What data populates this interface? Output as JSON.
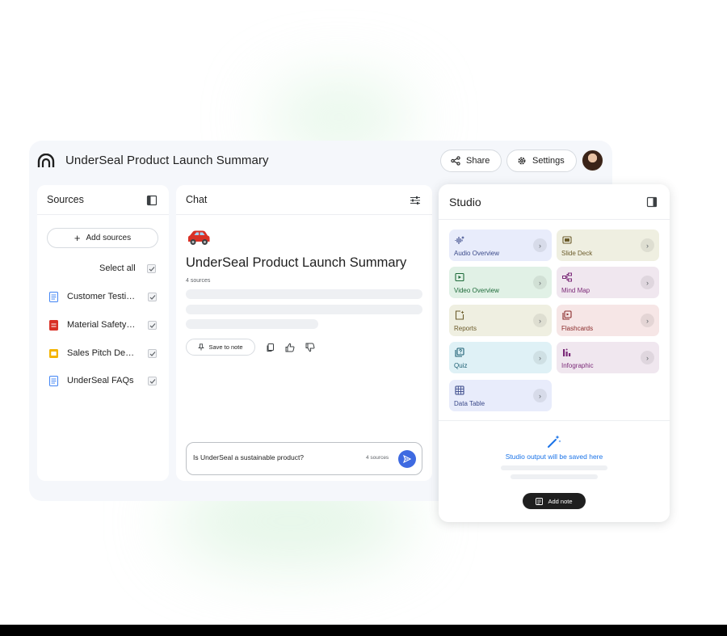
{
  "app": {
    "title": "UnderSeal Product Launch Summary",
    "share_label": "Share",
    "settings_label": "Settings"
  },
  "sources": {
    "title": "Sources",
    "add_label": "Add sources",
    "select_all_label": "Select all",
    "items": [
      {
        "label": "Customer Testi…",
        "icon": "doc-icon",
        "color": "#4285f4",
        "checked": true
      },
      {
        "label": "Material Safety…",
        "icon": "pdf-icon",
        "color": "#d93025",
        "checked": true
      },
      {
        "label": "Sales Pitch De…",
        "icon": "slides-icon",
        "color": "#f4b400",
        "checked": true
      },
      {
        "label": "UnderSeal FAQs",
        "icon": "doc-icon",
        "color": "#4285f4",
        "checked": true
      }
    ]
  },
  "chat": {
    "title": "Chat",
    "heading": "UnderSeal Product Launch Summary",
    "sources_count": "4 sources",
    "save_note_label": "Save to note",
    "input_value": "Is UnderSeal a sustainable product?",
    "input_sources": "4 sources"
  },
  "studio": {
    "title": "Studio",
    "tiles": [
      {
        "label": "Audio Overview",
        "icon": "audio-wave-icon",
        "bg": "#e8ecfb",
        "fg": "#3b4a8a"
      },
      {
        "label": "Slide Deck",
        "icon": "slides-icon",
        "bg": "#efefe1",
        "fg": "#6b5b2a"
      },
      {
        "label": "Video Overview",
        "icon": "video-icon",
        "bg": "#e1f1e6",
        "fg": "#1e6b3a"
      },
      {
        "label": "Mind Map",
        "icon": "mind-map-icon",
        "bg": "#f0e7ef",
        "fg": "#7b2a78"
      },
      {
        "label": "Reports",
        "icon": "reports-icon",
        "bg": "#efefe1",
        "fg": "#6b5b2a"
      },
      {
        "label": "Flashcards",
        "icon": "flashcards-icon",
        "bg": "#f6e6e6",
        "fg": "#8a2a2a"
      },
      {
        "label": "Quiz",
        "icon": "quiz-icon",
        "bg": "#dff1f6",
        "fg": "#1d5f73"
      },
      {
        "label": "Infographic",
        "icon": "infographic-icon",
        "bg": "#f0e7ef",
        "fg": "#7b2a78"
      },
      {
        "label": "Data Table",
        "icon": "table-icon",
        "bg": "#e8ecfb",
        "fg": "#3b4a8a"
      }
    ],
    "output_note": "Studio output will be saved here",
    "add_note_label": "Add note"
  }
}
